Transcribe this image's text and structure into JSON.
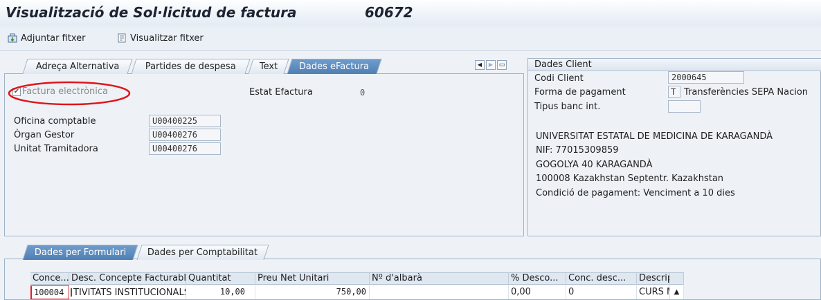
{
  "title": {
    "text": "Visualització de Sol·licitud de factura",
    "number": "60672"
  },
  "toolbar": {
    "attach_label": "Adjuntar fitxer",
    "view_label": "Visualitzar fitxer"
  },
  "tabs_top": [
    {
      "label": "Adreça Alternativa"
    },
    {
      "label": "Partides de despesa"
    },
    {
      "label": "Text"
    },
    {
      "label": "Dades eFactura"
    }
  ],
  "efactura": {
    "checkbox_label": "Factura electrònica",
    "checkbox_checked": true,
    "estat_label": "Estat Efactura",
    "estat_value": "0",
    "oficina_label": "Oficina comptable",
    "oficina_value": "U00400225",
    "organ_label": "Òrgan Gestor",
    "organ_value": "U00400276",
    "unitat_label": "Unitat Tramitadora",
    "unitat_value": "U00400276"
  },
  "client": {
    "header": "Dades Client",
    "codi_label": "Codi Client",
    "codi_value": "2000645",
    "forma_label": "Forma de pagament",
    "forma_code": "T",
    "forma_value": "Transferències SEPA Nacion",
    "banc_label": "Tipus banc int.",
    "banc_value": "",
    "address": [
      "UNIVERSITAT ESTATAL DE MEDICINA DE KARAGANDÀ",
      "NIF: 77015309859",
      "GOGOLYA 40 KARAGANDÀ",
      "100008 Kazakhstan Septentr. Kazakhstan",
      "Condició de pagament: Venciment a 10 dies"
    ]
  },
  "tabs_bottom": [
    {
      "label": "Dades per Formulari"
    },
    {
      "label": "Dades per Comptabilitat"
    }
  ],
  "table": {
    "headers": [
      "Conce...",
      "Desc. Concepte Facturable",
      "Quantitat",
      "Preu Net Unitari",
      "Nº d'albarà",
      "% Desco...",
      "Conc. desc...",
      "Descripc"
    ],
    "row": [
      "100004",
      "TIVITATS INSTITUCIONALS. CURSOS",
      "10,00",
      "750,00",
      "",
      "0,00",
      "0",
      "CURS M"
    ]
  }
}
